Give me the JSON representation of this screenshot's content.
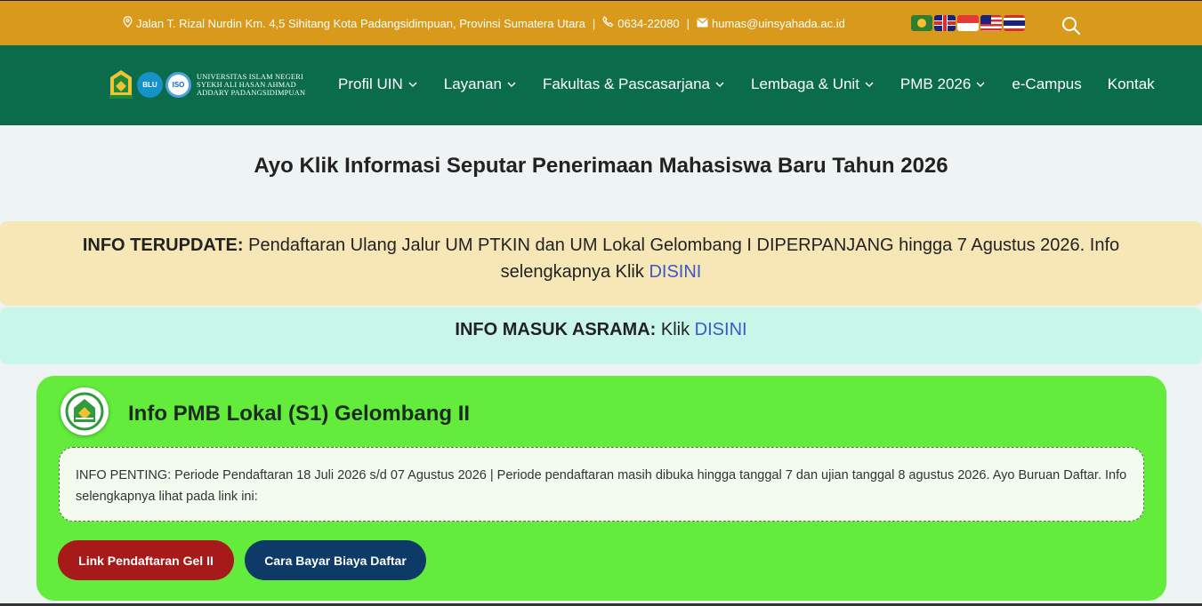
{
  "topbar": {
    "address": "Jalan T. Rizal Nurdin Km. 4,5 Sihitang Kota Padangsidimpuan, Provinsi Sumatera Utara",
    "phone": "0634-22080",
    "email": "humas@uinsyahada.ac.id",
    "separator": "|",
    "languages": [
      "arabic-flag",
      "english-flag",
      "indonesian-flag",
      "malay-flag",
      "thai-flag"
    ]
  },
  "nav": {
    "logo": {
      "blu": "BLU",
      "iso": "ISO",
      "line1": "UNIVERSITAS ISLAM NEGERI",
      "line2": "SYEKH ALI HASAN AHMAD",
      "line3": "ADDARY PADANGSIDIMPUAN"
    },
    "items": [
      {
        "label": "Profil UIN",
        "dropdown": true
      },
      {
        "label": "Layanan",
        "dropdown": true
      },
      {
        "label": "Fakultas & Pascasarjana",
        "dropdown": true
      },
      {
        "label": "Lembaga & Unit",
        "dropdown": true
      },
      {
        "label": "PMB 2026",
        "dropdown": true
      },
      {
        "label": "e-Campus",
        "dropdown": false
      },
      {
        "label": "Kontak",
        "dropdown": false
      }
    ]
  },
  "main": {
    "headline": "Ayo Klik Informasi Seputar Penerimaan Mahasiswa Baru Tahun 2026",
    "info_update": {
      "label": "INFO TERUPDATE:",
      "text": " Pendaftaran Ulang Jalur UM PTKIN dan UM Lokal Gelombang I DIPERPANJANG hingga 7 Agustus 2026. Info selengkapnya Klik ",
      "link": "DISINI"
    },
    "info_asrama": {
      "label": "INFO MASUK ASRAMA:",
      "text": " Klik ",
      "link": "DISINI"
    },
    "card": {
      "title": "Info PMB Lokal (S1) Gelombang II",
      "note": "INFO PENTING: Periode Pendaftaran 18 Juli 2026 s/d 07 Agustus 2026 | Periode pendaftaran masih dibuka hingga tanggal 7 dan ujian tanggal 8 agustus 2026. Ayo Buruan Daftar. Info selengkapnya lihat pada link ini:",
      "buttons": [
        "Link Pendaftaran Gel II",
        "Cara Bayar Biaya Daftar"
      ]
    }
  },
  "colors": {
    "topbar": "#d99a1b",
    "nav": "#0a6c4b",
    "info_update_bg": "#f7e7b6",
    "info_asrama_bg": "#c8f7ea",
    "card_bg": "#63ec3c",
    "button_red": "#a61a1a",
    "button_blue": "#0d3a66",
    "link": "#3d57c9"
  }
}
